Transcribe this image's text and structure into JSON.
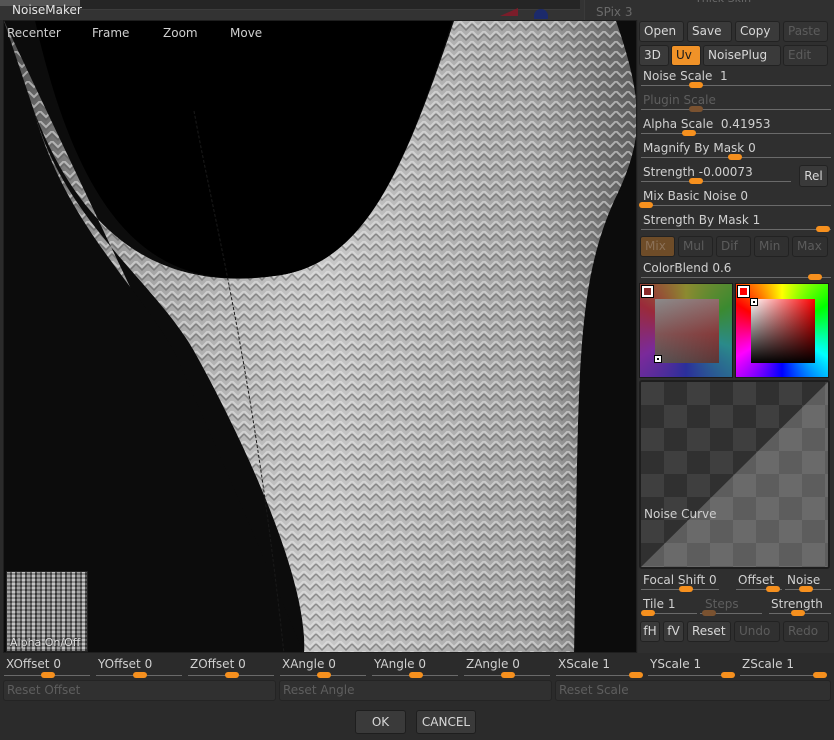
{
  "window": {
    "title": "NoiseMaker"
  },
  "background_app": {
    "spix_label": "SPix 3",
    "thick_skin_label": "Thick Skin"
  },
  "viewport": {
    "nav": [
      {
        "id": "recenter",
        "label": "Recenter"
      },
      {
        "id": "frame",
        "label": "Frame"
      },
      {
        "id": "zoom",
        "label": "Zoom"
      },
      {
        "id": "move",
        "label": "Move"
      }
    ],
    "alpha_toggle_label": "Alpha On/Off"
  },
  "panel": {
    "row1": [
      {
        "label": "Open",
        "state": "normal"
      },
      {
        "label": "Save",
        "state": "normal"
      },
      {
        "label": "Copy",
        "state": "normal"
      },
      {
        "label": "Paste",
        "state": "disabled"
      }
    ],
    "row2": [
      {
        "label": "3D",
        "state": "normal"
      },
      {
        "label": "Uv",
        "state": "active"
      },
      {
        "label": "NoisePlug",
        "state": "normal"
      },
      {
        "label": "Edit",
        "state": "disabled"
      }
    ],
    "sliders": {
      "noise_scale": {
        "label": "Noise Scale",
        "value": "1",
        "position": 0.28
      },
      "plugin_scale": {
        "label": "Plugin Scale",
        "value": "",
        "position": 0.28,
        "disabled": true
      },
      "alpha_scale": {
        "label": "Alpha Scale",
        "value": "0.41953",
        "position": 0.25
      },
      "magnify_by_mask": {
        "label": "Magnify By Mask",
        "value": "0",
        "position": 0.5
      },
      "strength": {
        "label": "Strength",
        "value": "-0.00073",
        "position": 0.5
      },
      "mix_basic_noise": {
        "label": "Mix Basic Noise",
        "value": "0",
        "position": 0.0
      },
      "strength_by_mask": {
        "label": "Strength By Mask",
        "value": "1",
        "position": 1.0
      },
      "color_blend": {
        "label": "ColorBlend",
        "value": "0.6",
        "position": 0.95
      }
    },
    "rel_label": "Rel",
    "blend_modes": [
      {
        "label": "Mix",
        "state": "dim-active"
      },
      {
        "label": "Mul",
        "state": "disabled"
      },
      {
        "label": "Dif",
        "state": "disabled"
      },
      {
        "label": "Min",
        "state": "disabled"
      },
      {
        "label": "Max",
        "state": "disabled"
      }
    ],
    "colors": {
      "left_swatch": "#8c2a2a",
      "right_swatch": "#ff0000",
      "accent": "#f6901e"
    },
    "noise_curve_label": "Noise Curve",
    "curve_sliders": {
      "focal_shift": {
        "label": "Focal Shift",
        "value": "0",
        "position": 0.5
      },
      "offset": {
        "label": "Offset",
        "value": "",
        "position": 1.0
      },
      "noise": {
        "label": "Noise",
        "value": "",
        "position": 0.5
      },
      "tile": {
        "label": "Tile",
        "value": "1",
        "position": 0.0
      },
      "steps": {
        "label": "Steps",
        "value": "",
        "position": 0.0,
        "disabled": true
      },
      "curve_strength": {
        "label": "Strength",
        "value": "",
        "position": 0.5
      }
    },
    "curve_buttons": [
      {
        "label": "fH",
        "state": "normal"
      },
      {
        "label": "fV",
        "state": "normal"
      },
      {
        "label": "Reset",
        "state": "normal"
      },
      {
        "label": "Undo",
        "state": "disabled"
      },
      {
        "label": "Redo",
        "state": "disabled"
      }
    ]
  },
  "transform": {
    "sliders": [
      {
        "label": "XOffset",
        "value": "0",
        "position": 0.5
      },
      {
        "label": "YOffset",
        "value": "0",
        "position": 0.5
      },
      {
        "label": "ZOffset",
        "value": "0",
        "position": 0.5
      },
      {
        "label": "XAngle",
        "value": "0",
        "position": 0.5
      },
      {
        "label": "YAngle",
        "value": "0",
        "position": 0.5
      },
      {
        "label": "ZAngle",
        "value": "0",
        "position": 0.5
      },
      {
        "label": "XScale",
        "value": "1",
        "position": 1.0
      },
      {
        "label": "YScale",
        "value": "1",
        "position": 1.0
      },
      {
        "label": "ZScale",
        "value": "1",
        "position": 1.0
      }
    ],
    "reset_offset_label": "Reset Offset",
    "reset_angle_label": "Reset Angle",
    "reset_scale_label": "Reset Scale"
  },
  "dialog": {
    "ok_label": "OK",
    "cancel_label": "CANCEL"
  }
}
